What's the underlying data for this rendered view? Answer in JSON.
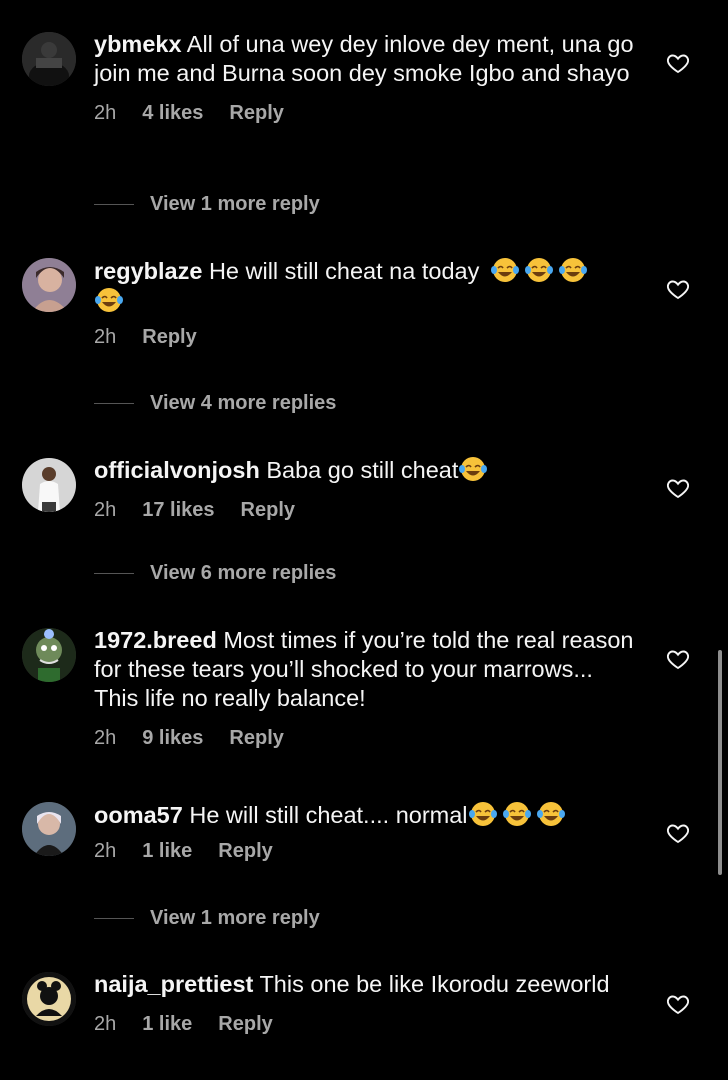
{
  "comments": [
    {
      "user": "ybmekx",
      "text": "All of una wey dey inlove dey ment, una go join me and Burna soon dey smoke Igbo and shayo",
      "time": "2h",
      "likes": "4 likes",
      "reply": "Reply",
      "more_replies": "View 1 more reply",
      "avatar_color": "#2a2a2a"
    },
    {
      "user": "regyblaze",
      "text": "He will still cheat na today",
      "time": "2h",
      "likes": "",
      "reply": "Reply",
      "more_replies": "View 4 more replies",
      "emoji_count": 4,
      "avatar_color": "#b08aa0"
    },
    {
      "user": "officialvonjosh",
      "text": "Baba go still cheat",
      "time": "2h",
      "likes": "17 likes",
      "reply": "Reply",
      "more_replies": "View 6 more replies",
      "emoji_count": 1,
      "avatar_color": "#d8d8d8"
    },
    {
      "user": "1972.breed",
      "text": "Most times if you’re told the real reason for these tears you’ll shocked to your marrows... This life no really balance!",
      "time": "2h",
      "likes": "9 likes",
      "reply": "Reply",
      "more_replies": "",
      "avatar_color": "#2b3a24"
    },
    {
      "user": "ooma57",
      "text": "He will still cheat.... normal",
      "time": "2h",
      "likes": "1 like",
      "reply": "Reply",
      "more_replies": "View 1 more reply",
      "emoji_count": 3,
      "avatar_color": "#6a7a8a"
    },
    {
      "user": "naija_prettiest",
      "text": "This one be like Ikorodu zeeworld",
      "time": "2h",
      "likes": "1 like",
      "reply": "Reply",
      "more_replies": "",
      "avatar_color": "#e9d8a6"
    }
  ],
  "icons": {
    "heart": "heart-outline-icon",
    "emoji": "face-with-tears-of-joy-emoji"
  }
}
